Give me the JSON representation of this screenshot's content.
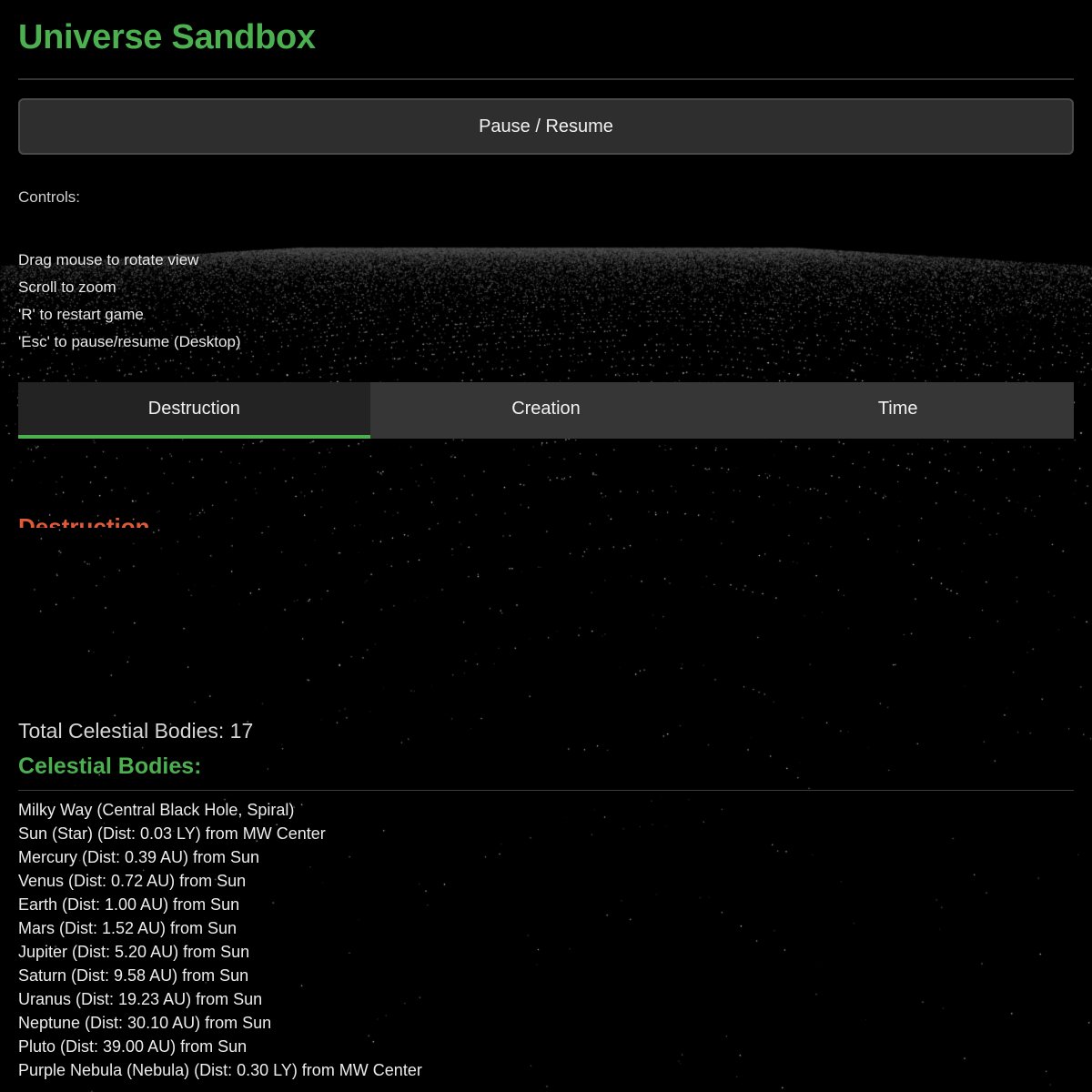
{
  "app": {
    "title": "Universe Sandbox",
    "accent_color": "#4caf50",
    "danger_color": "#e05a3a"
  },
  "toolbar": {
    "pause_label": "Pause / Resume"
  },
  "controls": {
    "label": "Controls:",
    "items": [
      "Drag mouse to rotate view",
      "Scroll to zoom",
      "'R' to restart game",
      "'Esc' to pause/resume (Desktop)"
    ]
  },
  "tabs": [
    {
      "label": "Destruction",
      "active": true
    },
    {
      "label": "Creation",
      "active": false
    },
    {
      "label": "Time",
      "active": false
    }
  ],
  "destruction": {
    "heading": "Destruction"
  },
  "stats": {
    "total_label": "Total Celestial Bodies: 17"
  },
  "bodies": {
    "heading": "Celestial Bodies:",
    "items": [
      "Milky Way (Central Black Hole, Spiral)",
      "Sun (Star) (Dist: 0.03 LY) from MW Center",
      "Mercury (Dist: 0.39 AU) from Sun",
      "Venus (Dist: 0.72 AU) from Sun",
      "Earth (Dist: 1.00 AU) from Sun",
      "Mars (Dist: 1.52 AU) from Sun",
      "Jupiter (Dist: 5.20 AU) from Sun",
      "Saturn (Dist: 9.58 AU) from Sun",
      "Uranus (Dist: 19.23 AU) from Sun",
      "Neptune (Dist: 30.10 AU) from Sun",
      "Pluto (Dist: 39.00 AU) from Sun",
      "Purple Nebula (Nebula) (Dist: 0.30 LY) from MW Center"
    ]
  }
}
